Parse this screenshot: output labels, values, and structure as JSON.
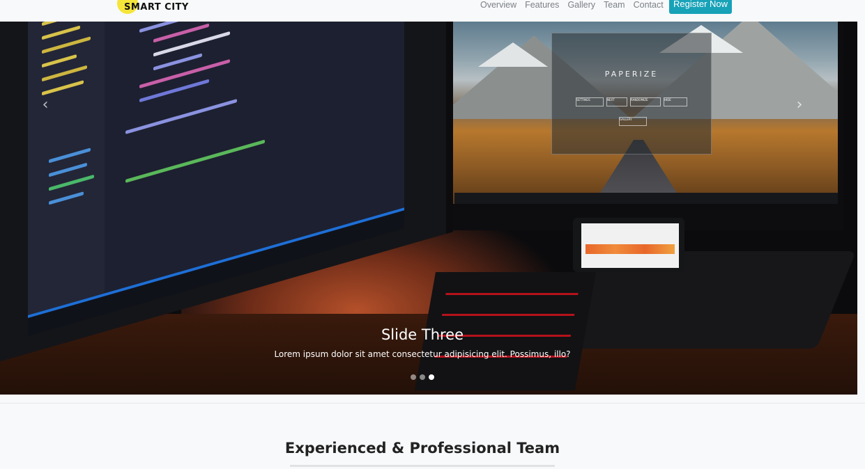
{
  "navbar": {
    "brand": "SMART CITY",
    "links": [
      "Overview",
      "Features",
      "Gallery",
      "Team",
      "Contact"
    ],
    "cta": "Register Now"
  },
  "carousel": {
    "caption_title": "Slide Three",
    "caption_text": "Lorem ipsum dolor sit amet consectetur adipisicing elit. Possimus, illo?",
    "slide_count": 3,
    "active_slide": 3,
    "screen_app_title": "PAPERIZE",
    "screen_app_buttons": [
      "SETTINGS",
      "NEXT",
      "RANDOMIZE",
      "HIDE"
    ],
    "screen_app_gallery": "GALLERY",
    "prev_icon": "chevron-left-icon",
    "next_icon": "chevron-right-icon"
  },
  "section": {
    "title": "Experienced & Professional Team"
  },
  "colors": {
    "accent": "#17a2b8",
    "background": "#f8f9fa",
    "brand_sun": "#f5e53b"
  }
}
